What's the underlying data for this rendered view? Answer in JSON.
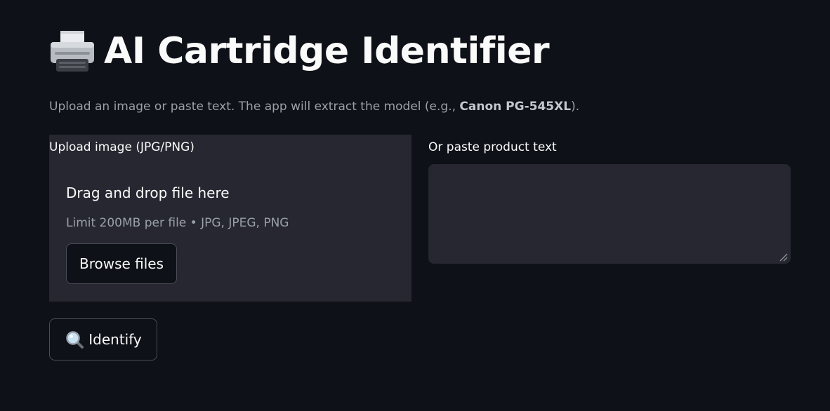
{
  "header": {
    "icon": "printer-icon",
    "title": "AI Cartridge Identifier"
  },
  "subtitle": {
    "text_before": "Upload an image or paste text. The app will extract the model (e.g., ",
    "example_model": "Canon PG-545XL",
    "text_after": ")."
  },
  "uploader": {
    "label": "Upload image (JPG/PNG)",
    "drop_title": "Drag and drop file here",
    "limit_text": "Limit 200MB per file • JPG, JPEG, PNG",
    "browse_label": "Browse files"
  },
  "text_input": {
    "label": "Or paste product text",
    "value": "",
    "placeholder": ""
  },
  "identify_button": {
    "icon": "magnifier-icon",
    "label": "Identify"
  },
  "colors": {
    "background": "#0e1117",
    "panel": "#262730",
    "text": "#fafafa",
    "muted": "#9aa0a8",
    "border": "#4a4d57"
  }
}
